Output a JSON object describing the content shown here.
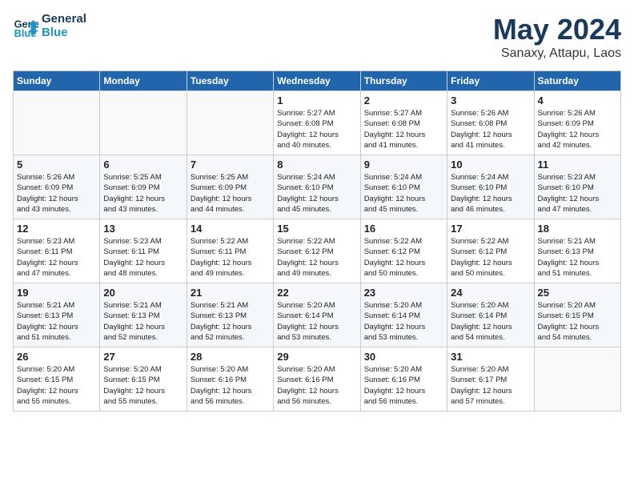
{
  "header": {
    "logo_line1": "General",
    "logo_line2": "Blue",
    "title": "May 2024",
    "subtitle": "Sanaxy, Attapu, Laos"
  },
  "days_of_week": [
    "Sunday",
    "Monday",
    "Tuesday",
    "Wednesday",
    "Thursday",
    "Friday",
    "Saturday"
  ],
  "weeks": [
    [
      {
        "day": "",
        "info": ""
      },
      {
        "day": "",
        "info": ""
      },
      {
        "day": "",
        "info": ""
      },
      {
        "day": "1",
        "info": "Sunrise: 5:27 AM\nSunset: 6:08 PM\nDaylight: 12 hours\nand 40 minutes."
      },
      {
        "day": "2",
        "info": "Sunrise: 5:27 AM\nSunset: 6:08 PM\nDaylight: 12 hours\nand 41 minutes."
      },
      {
        "day": "3",
        "info": "Sunrise: 5:26 AM\nSunset: 6:08 PM\nDaylight: 12 hours\nand 41 minutes."
      },
      {
        "day": "4",
        "info": "Sunrise: 5:26 AM\nSunset: 6:09 PM\nDaylight: 12 hours\nand 42 minutes."
      }
    ],
    [
      {
        "day": "5",
        "info": "Sunrise: 5:26 AM\nSunset: 6:09 PM\nDaylight: 12 hours\nand 43 minutes."
      },
      {
        "day": "6",
        "info": "Sunrise: 5:25 AM\nSunset: 6:09 PM\nDaylight: 12 hours\nand 43 minutes."
      },
      {
        "day": "7",
        "info": "Sunrise: 5:25 AM\nSunset: 6:09 PM\nDaylight: 12 hours\nand 44 minutes."
      },
      {
        "day": "8",
        "info": "Sunrise: 5:24 AM\nSunset: 6:10 PM\nDaylight: 12 hours\nand 45 minutes."
      },
      {
        "day": "9",
        "info": "Sunrise: 5:24 AM\nSunset: 6:10 PM\nDaylight: 12 hours\nand 45 minutes."
      },
      {
        "day": "10",
        "info": "Sunrise: 5:24 AM\nSunset: 6:10 PM\nDaylight: 12 hours\nand 46 minutes."
      },
      {
        "day": "11",
        "info": "Sunrise: 5:23 AM\nSunset: 6:10 PM\nDaylight: 12 hours\nand 47 minutes."
      }
    ],
    [
      {
        "day": "12",
        "info": "Sunrise: 5:23 AM\nSunset: 6:11 PM\nDaylight: 12 hours\nand 47 minutes."
      },
      {
        "day": "13",
        "info": "Sunrise: 5:23 AM\nSunset: 6:11 PM\nDaylight: 12 hours\nand 48 minutes."
      },
      {
        "day": "14",
        "info": "Sunrise: 5:22 AM\nSunset: 6:11 PM\nDaylight: 12 hours\nand 49 minutes."
      },
      {
        "day": "15",
        "info": "Sunrise: 5:22 AM\nSunset: 6:12 PM\nDaylight: 12 hours\nand 49 minutes."
      },
      {
        "day": "16",
        "info": "Sunrise: 5:22 AM\nSunset: 6:12 PM\nDaylight: 12 hours\nand 50 minutes."
      },
      {
        "day": "17",
        "info": "Sunrise: 5:22 AM\nSunset: 6:12 PM\nDaylight: 12 hours\nand 50 minutes."
      },
      {
        "day": "18",
        "info": "Sunrise: 5:21 AM\nSunset: 6:13 PM\nDaylight: 12 hours\nand 51 minutes."
      }
    ],
    [
      {
        "day": "19",
        "info": "Sunrise: 5:21 AM\nSunset: 6:13 PM\nDaylight: 12 hours\nand 51 minutes."
      },
      {
        "day": "20",
        "info": "Sunrise: 5:21 AM\nSunset: 6:13 PM\nDaylight: 12 hours\nand 52 minutes."
      },
      {
        "day": "21",
        "info": "Sunrise: 5:21 AM\nSunset: 6:13 PM\nDaylight: 12 hours\nand 52 minutes."
      },
      {
        "day": "22",
        "info": "Sunrise: 5:20 AM\nSunset: 6:14 PM\nDaylight: 12 hours\nand 53 minutes."
      },
      {
        "day": "23",
        "info": "Sunrise: 5:20 AM\nSunset: 6:14 PM\nDaylight: 12 hours\nand 53 minutes."
      },
      {
        "day": "24",
        "info": "Sunrise: 5:20 AM\nSunset: 6:14 PM\nDaylight: 12 hours\nand 54 minutes."
      },
      {
        "day": "25",
        "info": "Sunrise: 5:20 AM\nSunset: 6:15 PM\nDaylight: 12 hours\nand 54 minutes."
      }
    ],
    [
      {
        "day": "26",
        "info": "Sunrise: 5:20 AM\nSunset: 6:15 PM\nDaylight: 12 hours\nand 55 minutes."
      },
      {
        "day": "27",
        "info": "Sunrise: 5:20 AM\nSunset: 6:15 PM\nDaylight: 12 hours\nand 55 minutes."
      },
      {
        "day": "28",
        "info": "Sunrise: 5:20 AM\nSunset: 6:16 PM\nDaylight: 12 hours\nand 56 minutes."
      },
      {
        "day": "29",
        "info": "Sunrise: 5:20 AM\nSunset: 6:16 PM\nDaylight: 12 hours\nand 56 minutes."
      },
      {
        "day": "30",
        "info": "Sunrise: 5:20 AM\nSunset: 6:16 PM\nDaylight: 12 hours\nand 56 minutes."
      },
      {
        "day": "31",
        "info": "Sunrise: 5:20 AM\nSunset: 6:17 PM\nDaylight: 12 hours\nand 57 minutes."
      },
      {
        "day": "",
        "info": ""
      }
    ]
  ]
}
